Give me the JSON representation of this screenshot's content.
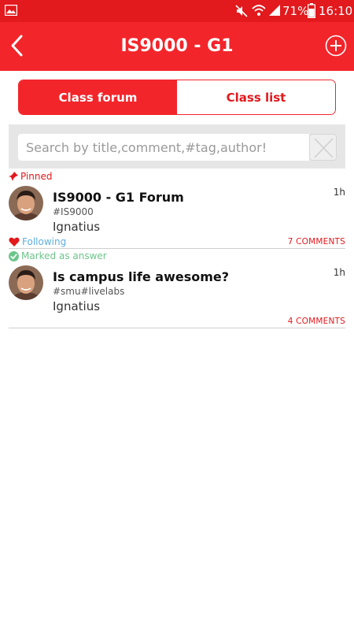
{
  "status_bar": {
    "battery": "71%",
    "time": "16:10",
    "icons": [
      "gallery-icon",
      "mute-icon",
      "wifi-icon",
      "signal-icon",
      "battery-icon"
    ]
  },
  "header": {
    "title": "IS9000 - G1",
    "back_icon": "chevron-left-icon",
    "add_icon": "plus-circle-icon"
  },
  "tabs": [
    {
      "label": "Class forum",
      "active": true
    },
    {
      "label": "Class list",
      "active": false
    }
  ],
  "search": {
    "placeholder": "Search by title,comment,#tag,author!",
    "value": ""
  },
  "posts": [
    {
      "badge": "Pinned",
      "title": "IS9000 - G1 Forum",
      "time": "1h",
      "tags": "#IS9000",
      "author": "Ignatius",
      "status": "Following",
      "comments": "7 COMMENTS"
    },
    {
      "badge": "Marked as answer",
      "title": "Is campus life awesome?",
      "time": "1h",
      "tags": "#smu#livelabs",
      "author": "Ignatius",
      "comments": "4 COMMENTS"
    }
  ],
  "colors": {
    "brand_red": "#f2252b",
    "status_bar_red": "#e2191d",
    "following_blue": "#5eaee0",
    "answered_green": "#6cc58a"
  }
}
